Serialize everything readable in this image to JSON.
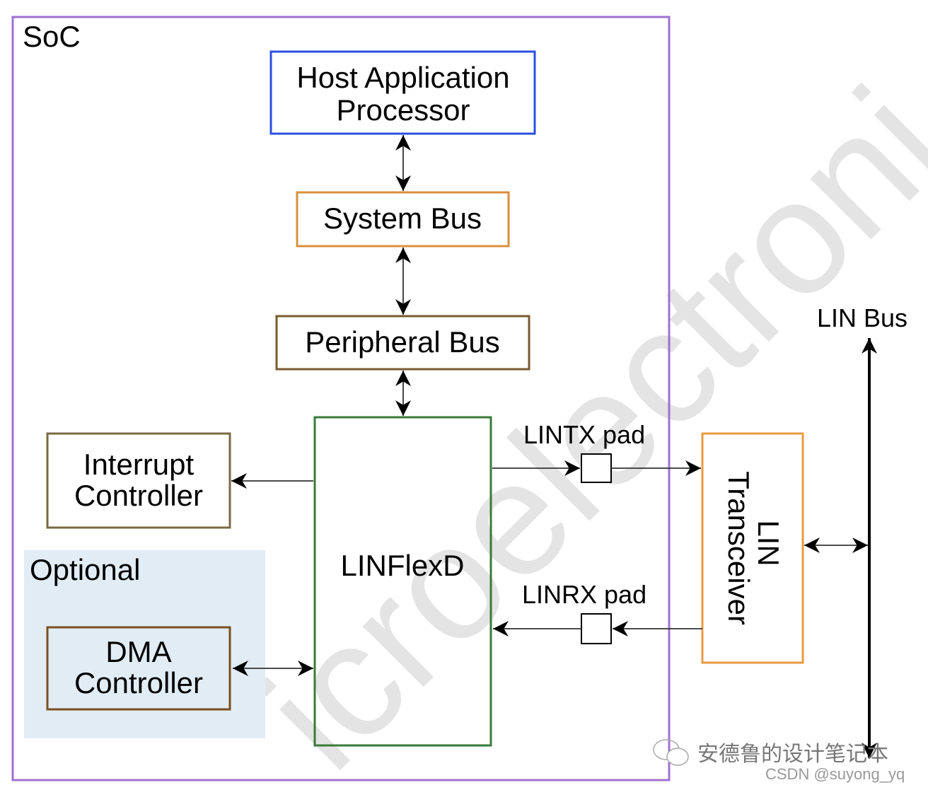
{
  "diagram": {
    "soc_label": "SoC",
    "host": {
      "line1": "Host Application",
      "line2": "Processor"
    },
    "system_bus": "System Bus",
    "peripheral_bus": "Peripheral Bus",
    "linflexd": "LINFlexD",
    "interrupt": {
      "line1": "Interrupt",
      "line2": "Controller"
    },
    "optional_label": "Optional",
    "dma": {
      "line1": "DMA",
      "line2": "Controller"
    },
    "lintx_pad": "LINTX pad",
    "linrx_pad": "LINRX pad",
    "transceiver": {
      "line1": "LIN",
      "line2": "Transceiver"
    },
    "lin_bus": "LIN Bus"
  },
  "watermark": {
    "text": "icroelectroni",
    "signature": "安德鲁的设计笔记本",
    "csdn": "CSDN @suyong_yq"
  },
  "colors": {
    "soc": "#a070d0",
    "host": "#2a4fe0",
    "system_bus": "#d8903c",
    "peripheral_bus": "#7a5a30",
    "linflexd": "#3a7a3a",
    "interrupt": "#7a6a40",
    "dma": "#7a5020",
    "optional_bg": "#e2ecf5",
    "transceiver": "#e89a40"
  }
}
